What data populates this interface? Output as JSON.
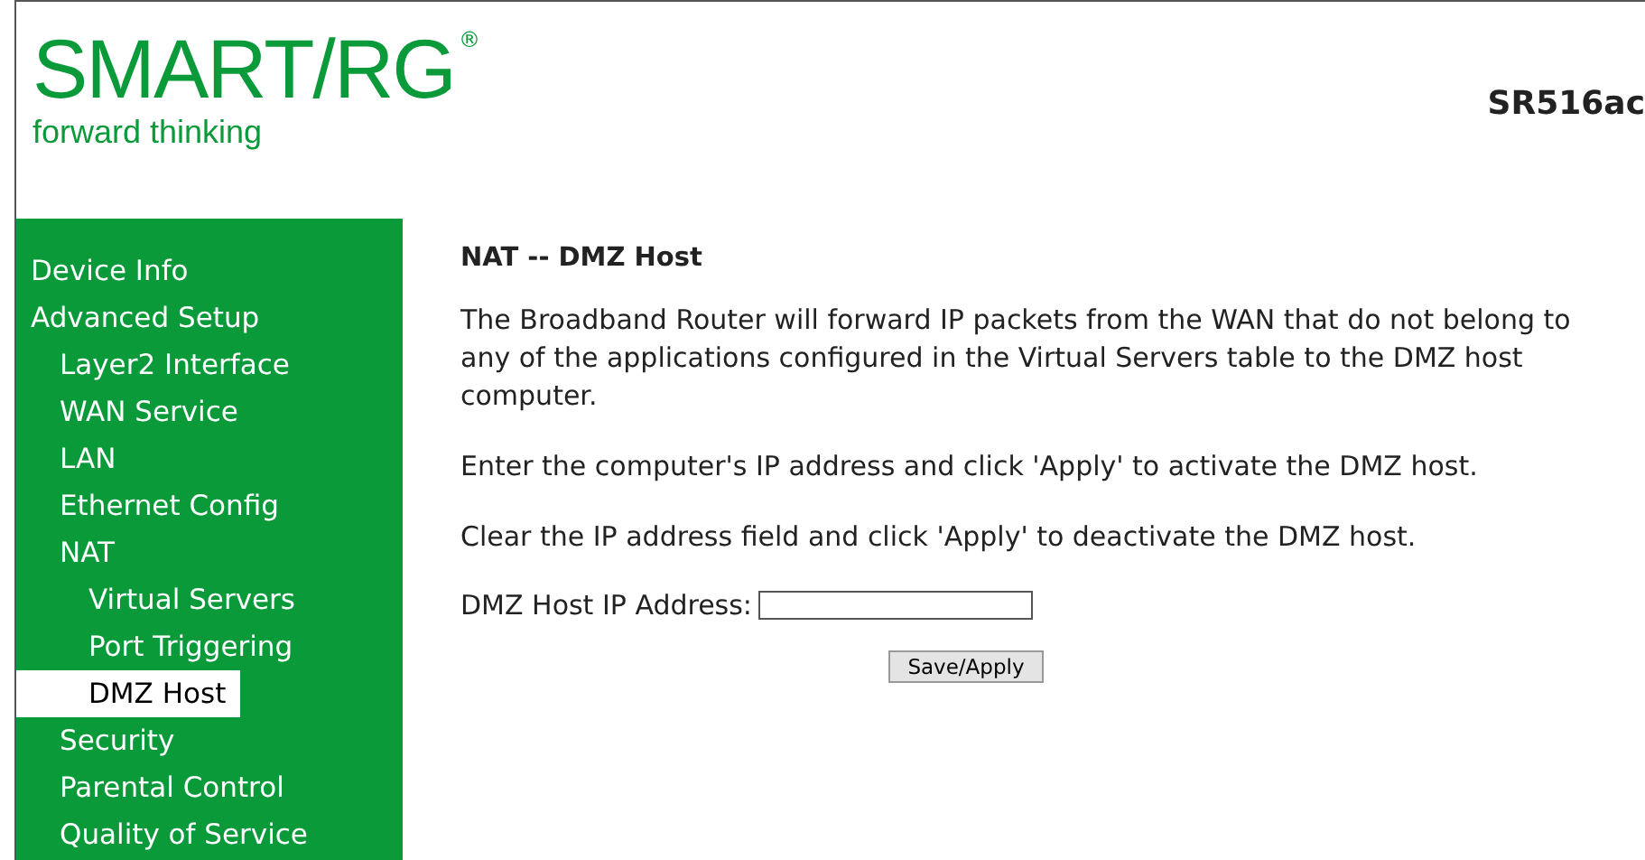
{
  "header": {
    "logo": "SMART/RG",
    "registered_mark": "®",
    "tagline": "forward thinking",
    "model": "SR516ac"
  },
  "sidebar": {
    "items": [
      {
        "label": "Device Info",
        "selected": false
      },
      {
        "label": "Advanced Setup",
        "selected": false,
        "children": [
          {
            "label": "Layer2 Interface",
            "selected": false
          },
          {
            "label": "WAN Service",
            "selected": false
          },
          {
            "label": "LAN",
            "selected": false
          },
          {
            "label": "Ethernet Config",
            "selected": false
          },
          {
            "label": "NAT",
            "selected": false,
            "children": [
              {
                "label": "Virtual Servers",
                "selected": false
              },
              {
                "label": "Port Triggering",
                "selected": false
              },
              {
                "label": "DMZ Host",
                "selected": true
              }
            ]
          },
          {
            "label": "Security",
            "selected": false
          },
          {
            "label": "Parental Control",
            "selected": false
          },
          {
            "label": "Quality of Service",
            "selected": false
          }
        ]
      }
    ]
  },
  "content": {
    "title": "NAT -- DMZ Host",
    "paragraphs": [
      "The Broadband Router will forward IP packets from the WAN that do not belong to any of the applications configured in the Virtual Servers table to the DMZ host computer.",
      "Enter the computer's IP address and click 'Apply' to activate the DMZ host.",
      "Clear the IP address field and click 'Apply' to deactivate the DMZ host."
    ],
    "field": {
      "label": "DMZ Host IP Address:"
    },
    "button": "Save/Apply"
  }
}
